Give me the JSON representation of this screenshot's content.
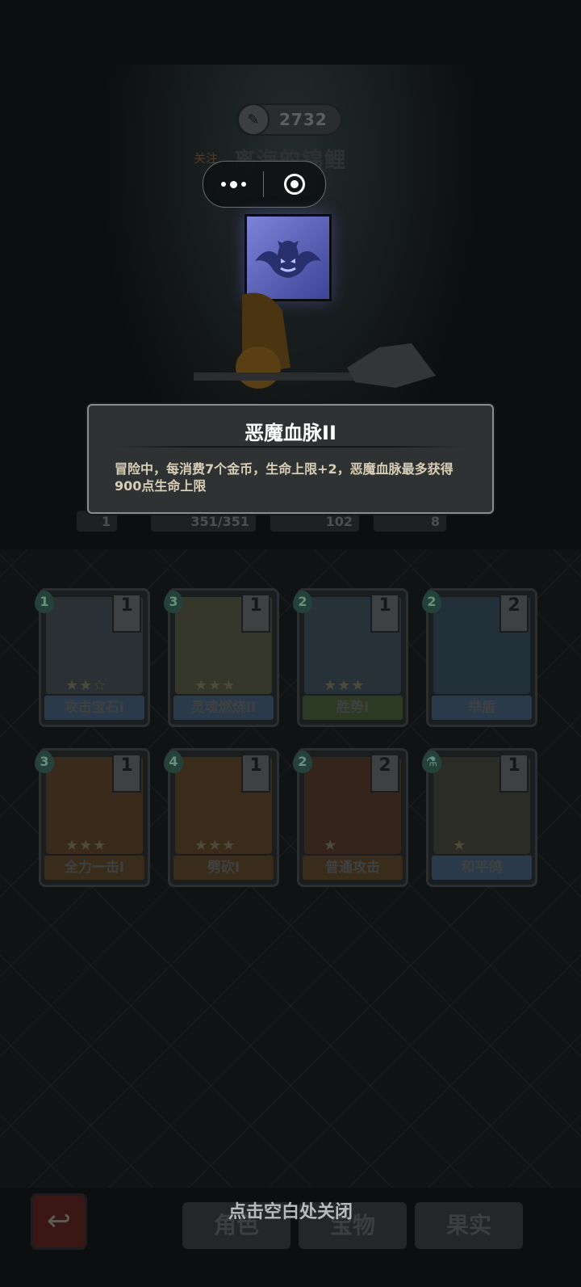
{
  "header": {
    "score": "2732",
    "follow_label": "关注",
    "username": "离海的锦鲤"
  },
  "capsule": {
    "menu_icon": "more-dots-icon",
    "close_icon": "record-circle-icon"
  },
  "skill_icon": "demon-bat-icon",
  "tooltip": {
    "title": "恶魔血脉II",
    "description": "冒险中，每消费7个金币，生命上限+2，恶魔血脉最多获得900点生命上限"
  },
  "stats": {
    "level": "1",
    "hp": "351/351",
    "attack": "102",
    "defense": "8"
  },
  "cards": [
    {
      "cost": "1",
      "count": "1",
      "name": "攻击宝石I",
      "stars": "★★☆",
      "color": "#2a3033"
    },
    {
      "cost": "3",
      "count": "1",
      "name": "灵魂燃烧II",
      "stars": "★★★",
      "color": "#35372a"
    },
    {
      "cost": "2",
      "count": "1",
      "name": "胜势I",
      "stars": "★★★",
      "color": "#263238"
    },
    {
      "cost": "2",
      "count": "2",
      "name": "举盾",
      "stars": "",
      "color": "#22303a"
    },
    {
      "cost": "3",
      "count": "1",
      "name": "全力一击I",
      "stars": "★★★",
      "color": "#3a2a1b"
    },
    {
      "cost": "4",
      "count": "1",
      "name": "劈砍I",
      "stars": "★★★",
      "color": "#3a2b1b"
    },
    {
      "cost": "2",
      "count": "2",
      "name": "普通攻击",
      "stars": "★",
      "color": "#34241b"
    },
    {
      "cost": "",
      "count": "1",
      "name": "和平鸽",
      "stars": "★",
      "color": "#2b2c26"
    }
  ],
  "bottom_tabs": [
    "角色",
    "宝物",
    "果实"
  ],
  "close_hint": "点击空白处关闭",
  "colors": {
    "tooltip_bg": "#2f3233",
    "tooltip_border": "#8a8d8e",
    "desc_text": "#d8cdb6"
  }
}
